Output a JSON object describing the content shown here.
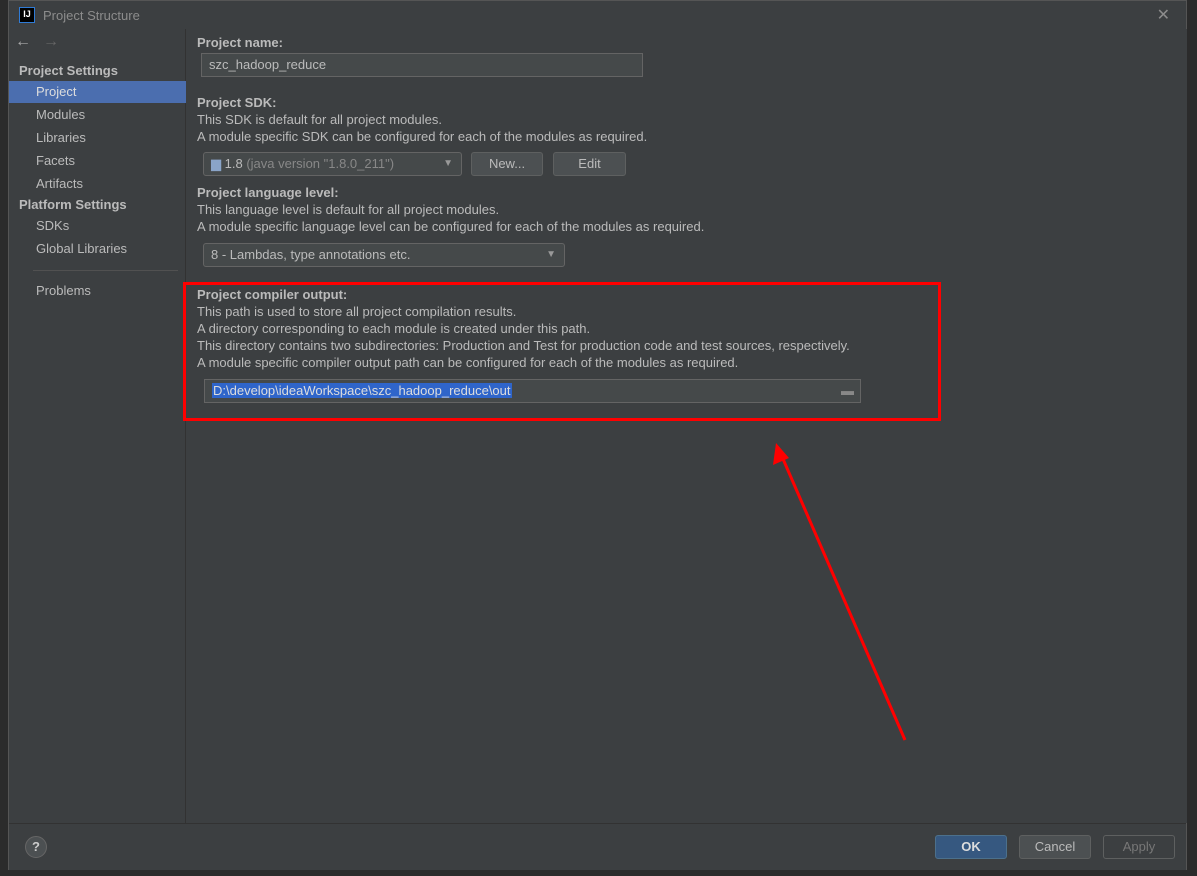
{
  "window": {
    "title": "Project Structure",
    "logo": "IJ"
  },
  "sidebar": {
    "project_settings": "Project Settings",
    "items": [
      {
        "label": "Project",
        "selected": true
      },
      {
        "label": "Modules"
      },
      {
        "label": "Libraries"
      },
      {
        "label": "Facets"
      },
      {
        "label": "Artifacts"
      }
    ],
    "platform_settings": "Platform Settings",
    "platform_items": [
      {
        "label": "SDKs"
      },
      {
        "label": "Global Libraries"
      }
    ],
    "problems": "Problems"
  },
  "main": {
    "name_label": "Project name:",
    "name_value": "szc_hadoop_reduce",
    "sdk_label": "Project SDK:",
    "sdk_desc1": "This SDK is default for all project modules.",
    "sdk_desc2": "A module specific SDK can be configured for each of the modules as required.",
    "sdk_value": "1.8",
    "sdk_detail": "(java version \"1.8.0_211\")",
    "new_button": "New...",
    "edit_button": "Edit",
    "lang_label": "Project language level:",
    "lang_desc1": "This language level is default for all project modules.",
    "lang_desc2": "A module specific language level can be configured for each of the modules as required.",
    "lang_value": "8 - Lambdas, type annotations etc.",
    "out_label": "Project compiler output:",
    "out_desc1": "This path is used to store all project compilation results.",
    "out_desc2": "A directory corresponding to each module is created under this path.",
    "out_desc3": "This directory contains two subdirectories: Production and Test for production code and test sources, respectively.",
    "out_desc4": "A module specific compiler output path can be configured for each of the modules as required.",
    "out_value": "D:\\develop\\ideaWorkspace\\szc_hadoop_reduce\\out"
  },
  "footer": {
    "help": "?",
    "ok": "OK",
    "cancel": "Cancel",
    "apply": "Apply"
  },
  "colors": {
    "annotation": "#ff0000",
    "selection": "#4b6eaf",
    "ok_button": "#365880"
  }
}
